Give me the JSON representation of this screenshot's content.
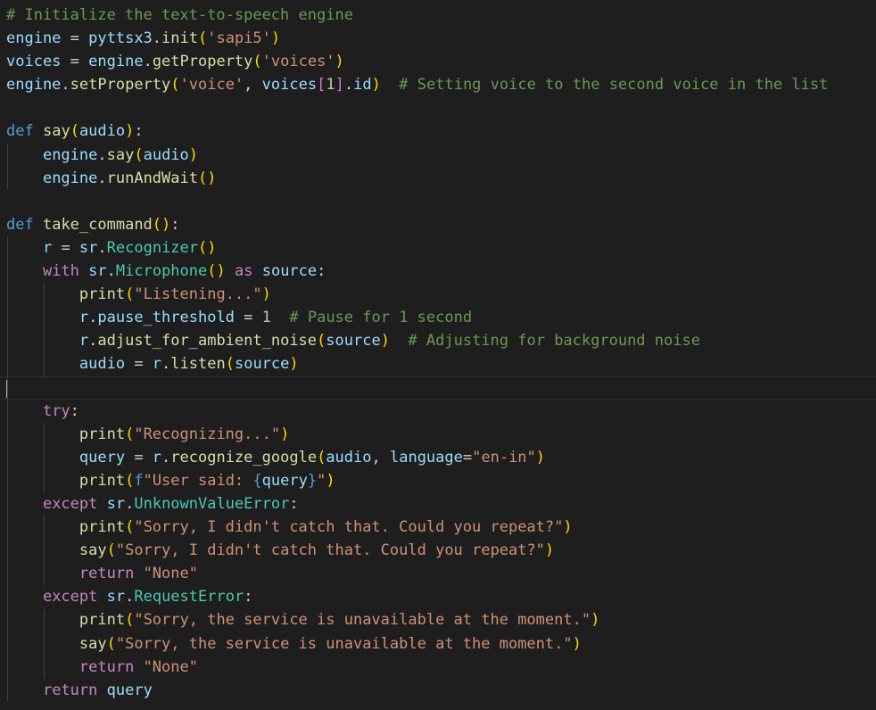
{
  "editor": {
    "theme_colors": {
      "background": "#1e1e1e",
      "comment": "#6a9955",
      "keyword": "#569cd6",
      "control": "#c586c0",
      "function": "#dcdcaa",
      "variable": "#9cdcfe",
      "class": "#4ec9b0",
      "string": "#ce9178",
      "number": "#b5cea8",
      "plain": "#d4d4d4",
      "bracket1": "#ffd700",
      "bracket2": "#da70d6",
      "bracket3": "#179fff"
    },
    "current_line": 16,
    "lines": [
      [
        [
          "comment",
          "# Initialize the text-to-speech engine"
        ]
      ],
      [
        [
          "variable",
          "engine"
        ],
        [
          "plain",
          " = "
        ],
        [
          "variable",
          "pyttsx3"
        ],
        [
          "plain",
          "."
        ],
        [
          "function",
          "init"
        ],
        [
          "bracket1",
          "("
        ],
        [
          "string",
          "'sapi5'"
        ],
        [
          "bracket1",
          ")"
        ]
      ],
      [
        [
          "variable",
          "voices"
        ],
        [
          "plain",
          " = "
        ],
        [
          "variable",
          "engine"
        ],
        [
          "plain",
          "."
        ],
        [
          "function",
          "getProperty"
        ],
        [
          "bracket1",
          "("
        ],
        [
          "string",
          "'voices'"
        ],
        [
          "bracket1",
          ")"
        ]
      ],
      [
        [
          "variable",
          "engine"
        ],
        [
          "plain",
          "."
        ],
        [
          "function",
          "setProperty"
        ],
        [
          "bracket1",
          "("
        ],
        [
          "string",
          "'voice'"
        ],
        [
          "plain",
          ", "
        ],
        [
          "variable",
          "voices"
        ],
        [
          "bracket2",
          "["
        ],
        [
          "number",
          "1"
        ],
        [
          "bracket2",
          "]"
        ],
        [
          "plain",
          "."
        ],
        [
          "variable",
          "id"
        ],
        [
          "bracket1",
          ")"
        ],
        [
          "plain",
          "  "
        ],
        [
          "comment",
          "# Setting voice to the second voice in the list"
        ]
      ],
      [],
      [
        [
          "keyword",
          "def"
        ],
        [
          "plain",
          " "
        ],
        [
          "function",
          "say"
        ],
        [
          "bracket1",
          "("
        ],
        [
          "param",
          "audio"
        ],
        [
          "bracket1",
          ")"
        ],
        [
          "plain",
          ":"
        ]
      ],
      [
        [
          "plain",
          "    "
        ],
        [
          "variable",
          "engine"
        ],
        [
          "plain",
          "."
        ],
        [
          "function",
          "say"
        ],
        [
          "bracket1",
          "("
        ],
        [
          "variable",
          "audio"
        ],
        [
          "bracket1",
          ")"
        ]
      ],
      [
        [
          "plain",
          "    "
        ],
        [
          "variable",
          "engine"
        ],
        [
          "plain",
          "."
        ],
        [
          "function",
          "runAndWait"
        ],
        [
          "bracket1",
          "()"
        ]
      ],
      [],
      [
        [
          "keyword",
          "def"
        ],
        [
          "plain",
          " "
        ],
        [
          "function",
          "take_command"
        ],
        [
          "bracket1",
          "()"
        ],
        [
          "plain",
          ":"
        ]
      ],
      [
        [
          "plain",
          "    "
        ],
        [
          "variable",
          "r"
        ],
        [
          "plain",
          " = "
        ],
        [
          "variable",
          "sr"
        ],
        [
          "plain",
          "."
        ],
        [
          "class",
          "Recognizer"
        ],
        [
          "bracket1",
          "()"
        ]
      ],
      [
        [
          "plain",
          "    "
        ],
        [
          "control",
          "with"
        ],
        [
          "plain",
          " "
        ],
        [
          "variable",
          "sr"
        ],
        [
          "plain",
          "."
        ],
        [
          "class",
          "Microphone"
        ],
        [
          "bracket1",
          "()"
        ],
        [
          "plain",
          " "
        ],
        [
          "control",
          "as"
        ],
        [
          "plain",
          " "
        ],
        [
          "variable",
          "source"
        ],
        [
          "plain",
          ":"
        ]
      ],
      [
        [
          "plain",
          "        "
        ],
        [
          "function",
          "print"
        ],
        [
          "bracket1",
          "("
        ],
        [
          "string",
          "\"Listening...\""
        ],
        [
          "bracket1",
          ")"
        ]
      ],
      [
        [
          "plain",
          "        "
        ],
        [
          "variable",
          "r"
        ],
        [
          "plain",
          "."
        ],
        [
          "variable",
          "pause_threshold"
        ],
        [
          "plain",
          " = "
        ],
        [
          "number",
          "1"
        ],
        [
          "plain",
          "  "
        ],
        [
          "comment",
          "# Pause for 1 second"
        ]
      ],
      [
        [
          "plain",
          "        "
        ],
        [
          "variable",
          "r"
        ],
        [
          "plain",
          "."
        ],
        [
          "function",
          "adjust_for_ambient_noise"
        ],
        [
          "bracket1",
          "("
        ],
        [
          "variable",
          "source"
        ],
        [
          "bracket1",
          ")"
        ],
        [
          "plain",
          "  "
        ],
        [
          "comment",
          "# Adjusting for background noise"
        ]
      ],
      [
        [
          "plain",
          "        "
        ],
        [
          "variable",
          "audio"
        ],
        [
          "plain",
          " = "
        ],
        [
          "variable",
          "r"
        ],
        [
          "plain",
          "."
        ],
        [
          "function",
          "listen"
        ],
        [
          "bracket1",
          "("
        ],
        [
          "variable",
          "source"
        ],
        [
          "bracket1",
          ")"
        ]
      ],
      [],
      [
        [
          "plain",
          "    "
        ],
        [
          "control",
          "try"
        ],
        [
          "plain",
          ":"
        ]
      ],
      [
        [
          "plain",
          "        "
        ],
        [
          "function",
          "print"
        ],
        [
          "bracket1",
          "("
        ],
        [
          "string",
          "\"Recognizing...\""
        ],
        [
          "bracket1",
          ")"
        ]
      ],
      [
        [
          "plain",
          "        "
        ],
        [
          "variable",
          "query"
        ],
        [
          "plain",
          " = "
        ],
        [
          "variable",
          "r"
        ],
        [
          "plain",
          "."
        ],
        [
          "function",
          "recognize_google"
        ],
        [
          "bracket1",
          "("
        ],
        [
          "variable",
          "audio"
        ],
        [
          "plain",
          ", "
        ],
        [
          "param",
          "language"
        ],
        [
          "plain",
          "="
        ],
        [
          "string",
          "\"en-in\""
        ],
        [
          "bracket1",
          ")"
        ]
      ],
      [
        [
          "plain",
          "        "
        ],
        [
          "function",
          "print"
        ],
        [
          "bracket1",
          "("
        ],
        [
          "keyword",
          "f"
        ],
        [
          "string",
          "\"User said: "
        ],
        [
          "keyword",
          "{"
        ],
        [
          "variable",
          "query"
        ],
        [
          "keyword",
          "}"
        ],
        [
          "string",
          "\""
        ],
        [
          "bracket1",
          ")"
        ]
      ],
      [
        [
          "plain",
          "    "
        ],
        [
          "control",
          "except"
        ],
        [
          "plain",
          " "
        ],
        [
          "variable",
          "sr"
        ],
        [
          "plain",
          "."
        ],
        [
          "class",
          "UnknownValueError"
        ],
        [
          "plain",
          ":"
        ]
      ],
      [
        [
          "plain",
          "        "
        ],
        [
          "function",
          "print"
        ],
        [
          "bracket1",
          "("
        ],
        [
          "string",
          "\"Sorry, I didn't catch that. Could you repeat?\""
        ],
        [
          "bracket1",
          ")"
        ]
      ],
      [
        [
          "plain",
          "        "
        ],
        [
          "function",
          "say"
        ],
        [
          "bracket1",
          "("
        ],
        [
          "string",
          "\"Sorry, I didn't catch that. Could you repeat?\""
        ],
        [
          "bracket1",
          ")"
        ]
      ],
      [
        [
          "plain",
          "        "
        ],
        [
          "control",
          "return"
        ],
        [
          "plain",
          " "
        ],
        [
          "string",
          "\"None\""
        ]
      ],
      [
        [
          "plain",
          "    "
        ],
        [
          "control",
          "except"
        ],
        [
          "plain",
          " "
        ],
        [
          "variable",
          "sr"
        ],
        [
          "plain",
          "."
        ],
        [
          "class",
          "RequestError"
        ],
        [
          "plain",
          ":"
        ]
      ],
      [
        [
          "plain",
          "        "
        ],
        [
          "function",
          "print"
        ],
        [
          "bracket1",
          "("
        ],
        [
          "string",
          "\"Sorry, the service is unavailable at the moment.\""
        ],
        [
          "bracket1",
          ")"
        ]
      ],
      [
        [
          "plain",
          "        "
        ],
        [
          "function",
          "say"
        ],
        [
          "bracket1",
          "("
        ],
        [
          "string",
          "\"Sorry, the service is unavailable at the moment.\""
        ],
        [
          "bracket1",
          ")"
        ]
      ],
      [
        [
          "plain",
          "        "
        ],
        [
          "control",
          "return"
        ],
        [
          "plain",
          " "
        ],
        [
          "string",
          "\"None\""
        ]
      ],
      [
        [
          "plain",
          "    "
        ],
        [
          "control",
          "return"
        ],
        [
          "plain",
          " "
        ],
        [
          "variable",
          "query"
        ]
      ]
    ]
  }
}
